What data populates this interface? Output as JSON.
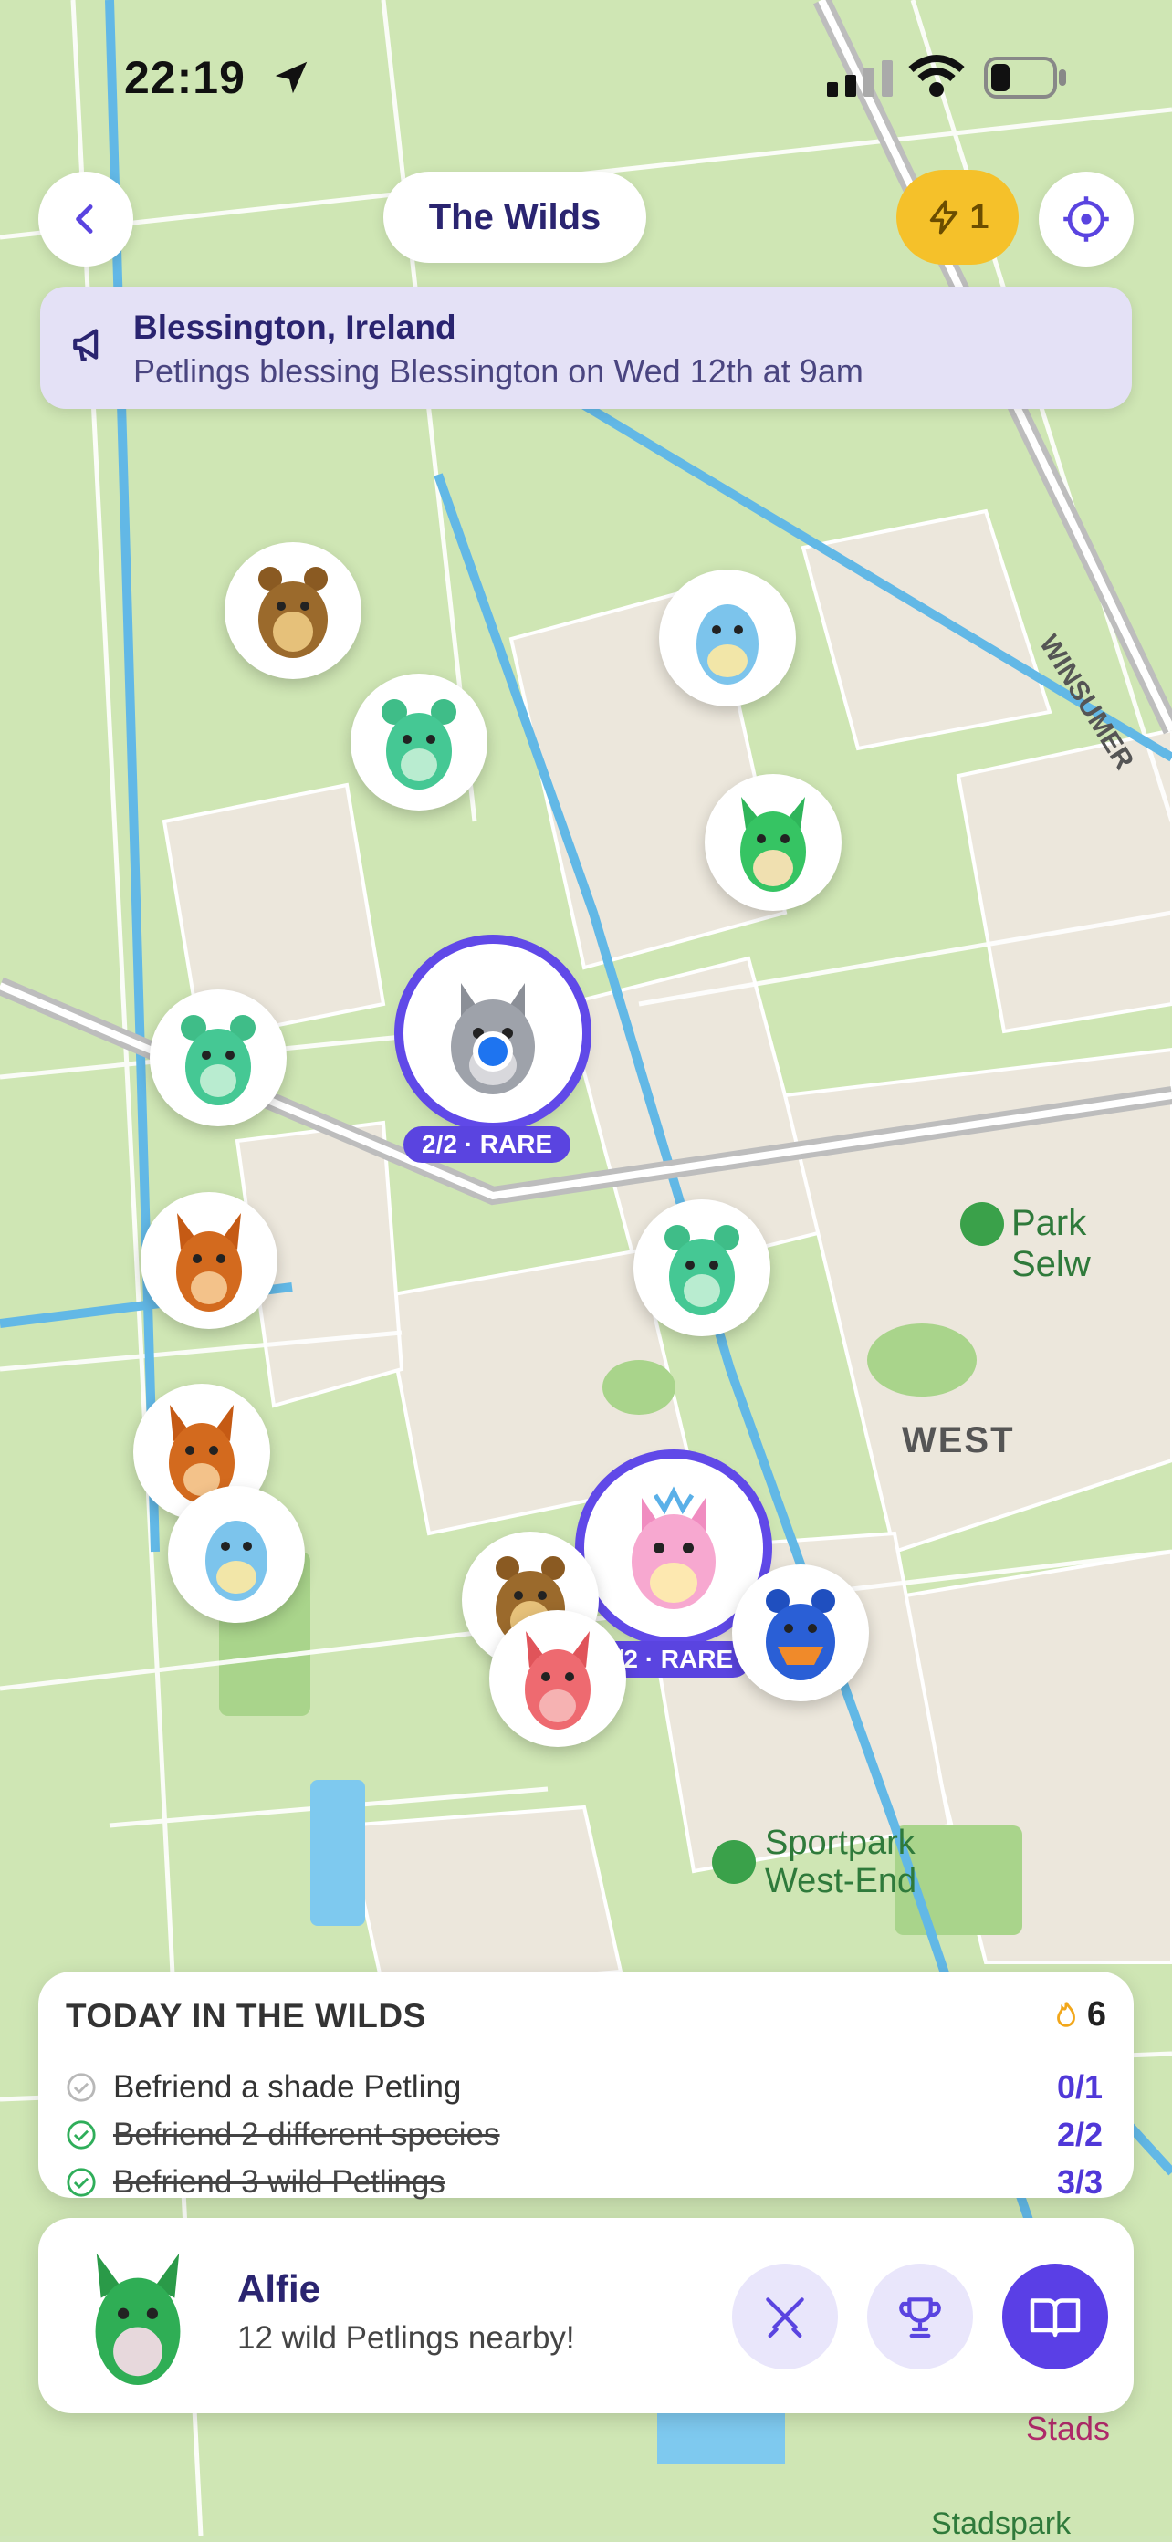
{
  "status_bar": {
    "time": "22:19"
  },
  "header": {
    "title": "The Wilds",
    "energy_count": "1"
  },
  "banner": {
    "location": "Blessington, Ireland",
    "message": "Petlings blessing Blessington on Wed 12th at 9am"
  },
  "map": {
    "labels": {
      "park": "Park Selw",
      "district": "WEST",
      "road": "WINSUMER",
      "sportpark_line1": "Sportpark",
      "sportpark_line2": "West-End",
      "stadspark": "Stadspark",
      "stads": "Stads"
    },
    "rare_tags": [
      "2/2 · RARE",
      "0/2 · RARE"
    ]
  },
  "quests": {
    "title": "TODAY IN THE WILDS",
    "streak": "6",
    "items": [
      {
        "text": "Befriend a shade Petling",
        "progress": "0/1",
        "done": false
      },
      {
        "text": "Befriend 2 different species",
        "progress": "2/2",
        "done": true
      },
      {
        "text": "Befriend 3 wild Petlings",
        "progress": "3/3",
        "done": true
      }
    ]
  },
  "companion": {
    "name": "Alfie",
    "status": "12 wild Petlings nearby!"
  },
  "colors": {
    "accent": "#5a3fe6",
    "energy": "#f5c12a",
    "banner": "#e4e1f6"
  },
  "icons": [
    "back-icon",
    "lightning-icon",
    "crosshair-icon",
    "megaphone-icon",
    "flame-icon",
    "check-circle-icon",
    "swords-icon",
    "trophy-icon",
    "book-icon"
  ]
}
